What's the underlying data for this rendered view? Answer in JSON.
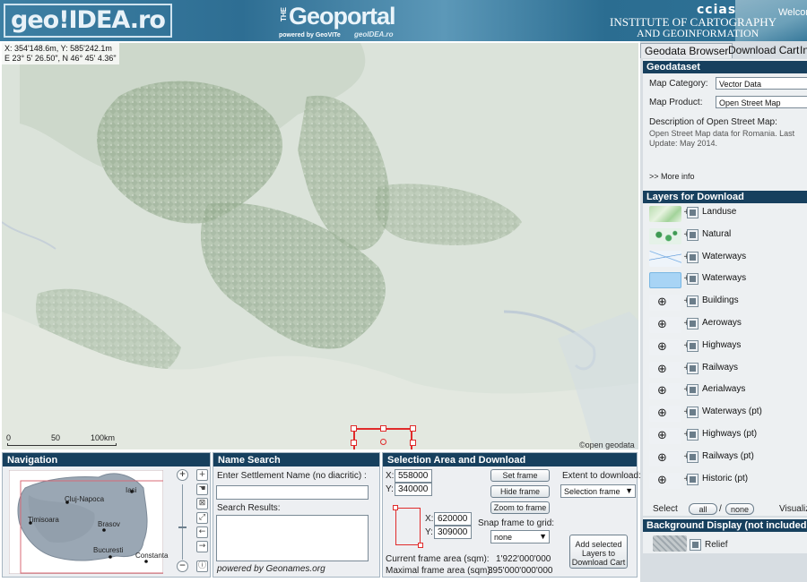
{
  "header": {
    "logo": "geo!IDEA.ro",
    "portal_the": "THE",
    "portal_title": "Geoportal",
    "powered": "powered by GeoVITe",
    "sub": "geoIDEA.ro",
    "ccias": "ccias",
    "institute_line1": "INSTITUTE OF CARTOGRAPHY",
    "institute_line2": "AND GEOINFORMATION",
    "welcome": "Welcome"
  },
  "map": {
    "coords_line1": "X: 354'148.6m, Y: 585'242.1m",
    "coords_line2": "E 23° 5' 26.50\", N 46° 45' 4.36\"",
    "scale_labels": [
      "0",
      "50",
      "100km"
    ],
    "attribution": "©open geodata"
  },
  "navigation": {
    "title": "Navigation",
    "zoom_in": "+",
    "zoom_out": "−",
    "cities": [
      "Cluj-Napoca",
      "Iasi",
      "Timisoara",
      "Brasov",
      "Bucuresti",
      "Constanta"
    ]
  },
  "name_search": {
    "title": "Name Search",
    "prompt": "Enter Settlement Name (no diacritic) :",
    "input_value": "",
    "results_label": "Search Results:",
    "powered_by": "powered by Geonames.org"
  },
  "selection": {
    "title": "Selection Area and Download",
    "x1_label": "X:",
    "x1": "558000",
    "y1_label": "Y:",
    "y1": "340000",
    "x2_label": "X:",
    "x2": "620000",
    "y2_label": "Y:",
    "y2": "309000",
    "set_frame": "Set frame",
    "hide_frame": "Hide frame",
    "zoom_to_frame": "Zoom to frame",
    "extent_label": "Extent to download:",
    "extent_value": "Selection frame",
    "snap_label": "Snap frame to grid:",
    "snap_value": "none",
    "add_button": "Add selected Layers to Download Cart",
    "current_area_label": "Current frame area (sqm):",
    "current_area": "1'922'000'000",
    "max_area_label": "Maximal frame area (sqm):",
    "max_area": "395'000'000'000"
  },
  "right_panel": {
    "tabs": [
      "Geodata Browser",
      "Download Cart",
      "Info"
    ],
    "geodataset": {
      "title": "Geodataset",
      "category_label": "Map Category:",
      "category_value": "Vector Data",
      "product_label": "Map Product:",
      "product_value": "Open Street Map",
      "desc_title": "Description of Open Street Map:",
      "desc_text": "Open Street Map data for Romania. Last Update: May 2014.",
      "more_info": ">> More info"
    },
    "layers_title": "Layers for Download",
    "layers": [
      {
        "name": "Landuse",
        "thumb": "landuse"
      },
      {
        "name": "Natural",
        "thumb": "natural"
      },
      {
        "name": "Waterways",
        "thumb": "waterlines"
      },
      {
        "name": "Waterways",
        "thumb": "waterarea"
      },
      {
        "name": "Buildings",
        "thumb": "zoom-icon"
      },
      {
        "name": "Aeroways",
        "thumb": "zoom-icon"
      },
      {
        "name": "Highways",
        "thumb": "zoom-icon"
      },
      {
        "name": "Railways",
        "thumb": "zoom-icon"
      },
      {
        "name": "Aerialways",
        "thumb": "zoom-icon"
      },
      {
        "name": "Waterways (pt)",
        "thumb": "zoom-icon"
      },
      {
        "name": "Highways (pt)",
        "thumb": "zoom-icon"
      },
      {
        "name": "Railways (pt)",
        "thumb": "zoom-icon"
      },
      {
        "name": "Historic (pt)",
        "thumb": "zoom-icon"
      }
    ],
    "select_label": "Select",
    "select_all": "all",
    "select_none": "none",
    "visualize": "Visualize",
    "background_title": "Background Display (not included in download)",
    "background_item": "Relief"
  }
}
